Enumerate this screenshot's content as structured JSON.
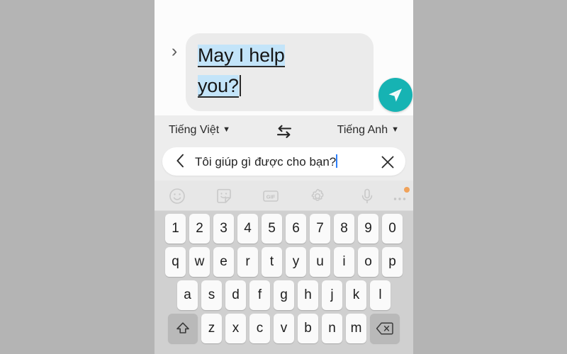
{
  "chat": {
    "chevron_icon": "chevron-right-icon",
    "message_text": "May I help you?",
    "message_line1": "May I help",
    "message_line2": "you?",
    "send_icon": "send-paper-plane-icon"
  },
  "translate": {
    "source_language": "Tiếng Việt",
    "target_language": "Tiếng Anh",
    "caret_glyph": "▼",
    "swap_icon": "swap-horizontal-icon",
    "back_glyph": "‹",
    "input_value": "Tôi giúp gì được cho bạn?",
    "clear_icon": "close-x-icon"
  },
  "keyboard_toolbar": {
    "items": [
      {
        "name": "emoji-icon",
        "label": "Emoji"
      },
      {
        "name": "sticker-icon",
        "label": "Sticker"
      },
      {
        "name": "gif-icon",
        "label": "GIF"
      },
      {
        "name": "settings-gear-icon",
        "label": "Settings"
      },
      {
        "name": "microphone-icon",
        "label": "Voice input"
      },
      {
        "name": "more-options-icon",
        "label": "More"
      }
    ],
    "gif_label": "GIF",
    "has_notification_badge": true
  },
  "keyboard": {
    "row_numbers": [
      "1",
      "2",
      "3",
      "4",
      "5",
      "6",
      "7",
      "8",
      "9",
      "0"
    ],
    "row_top": [
      "q",
      "w",
      "e",
      "r",
      "t",
      "y",
      "u",
      "i",
      "o",
      "p"
    ],
    "row_home": [
      "a",
      "s",
      "d",
      "f",
      "g",
      "h",
      "j",
      "k",
      "l"
    ],
    "row_bottom": [
      "z",
      "x",
      "c",
      "v",
      "b",
      "n",
      "m"
    ],
    "shift_icon": "shift-arrow-icon",
    "backspace_icon": "backspace-delete-icon"
  },
  "colors": {
    "page_background": "#b4b4b4",
    "bubble": "#ebebeb",
    "highlight": "#c3e4f9",
    "send_button": "#16b3b3",
    "keyboard_background": "#d0d0d0",
    "key": "#fafafa",
    "modifier_key": "#b9b9b9",
    "badge": "#f0a25a",
    "cursor": "#2d7ff9"
  }
}
